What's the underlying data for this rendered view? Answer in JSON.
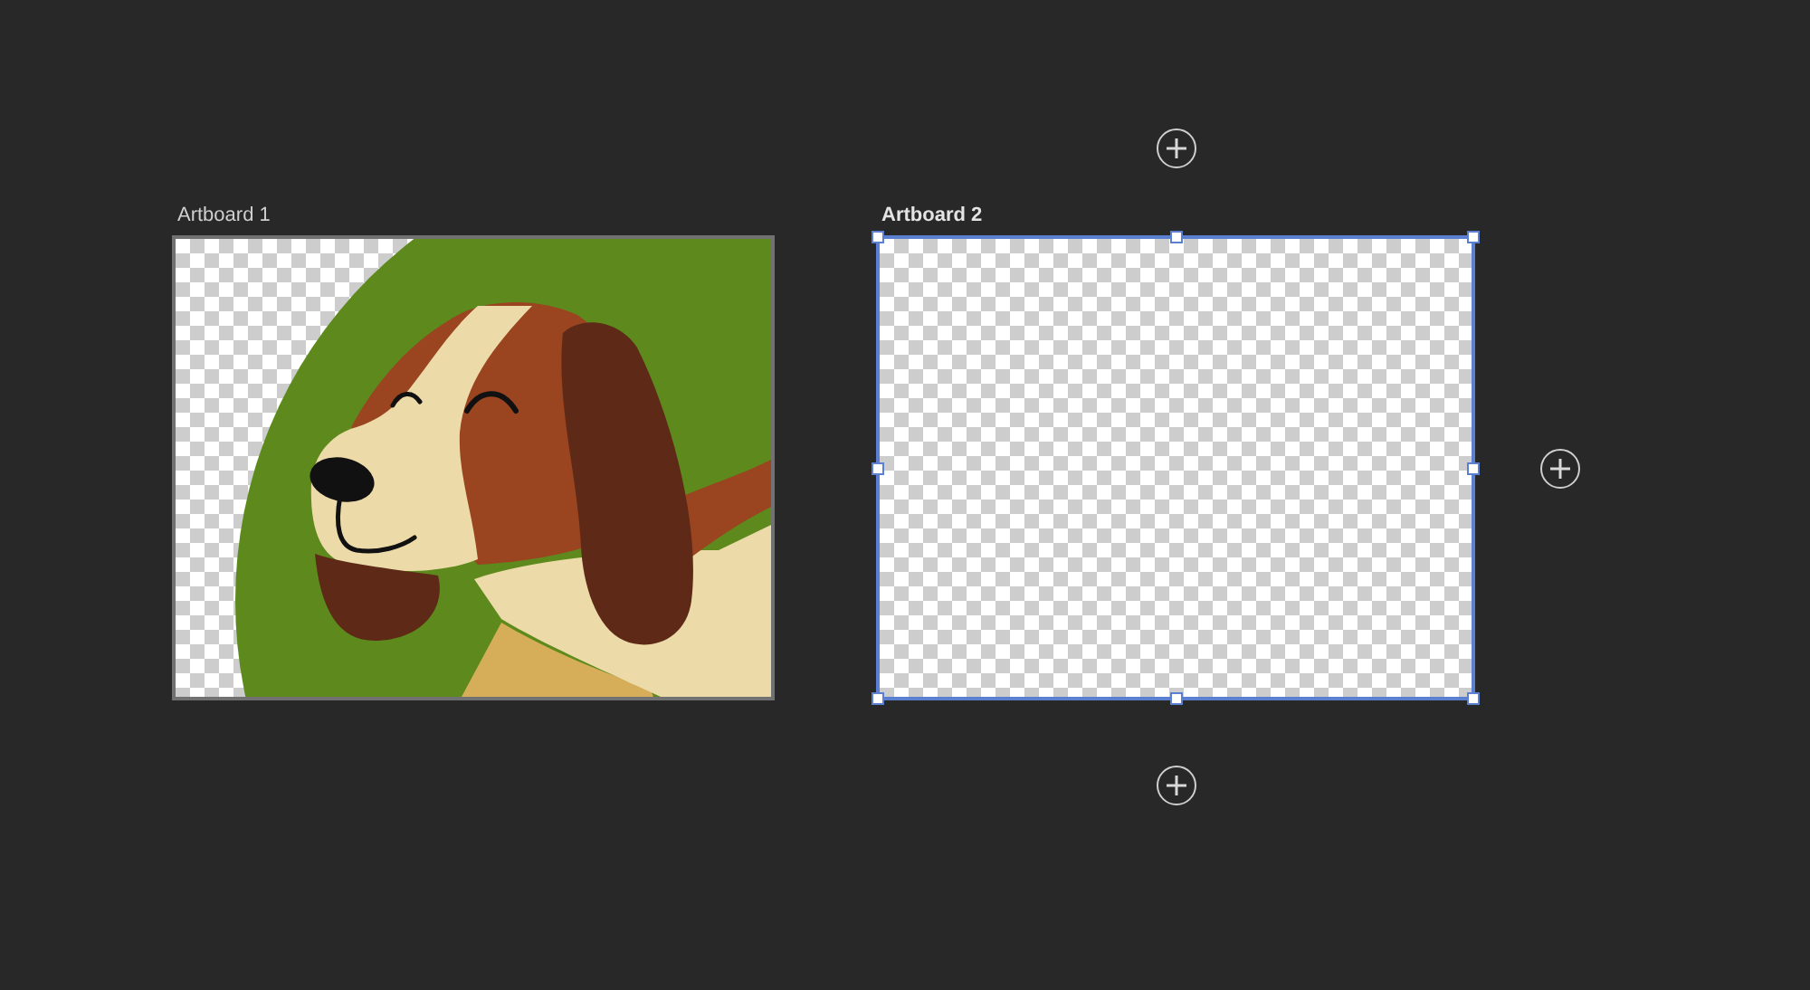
{
  "artboards": [
    {
      "label": "Artboard 1",
      "selected": false,
      "kind": "image"
    },
    {
      "label": "Artboard 2",
      "selected": true,
      "kind": "empty"
    }
  ]
}
